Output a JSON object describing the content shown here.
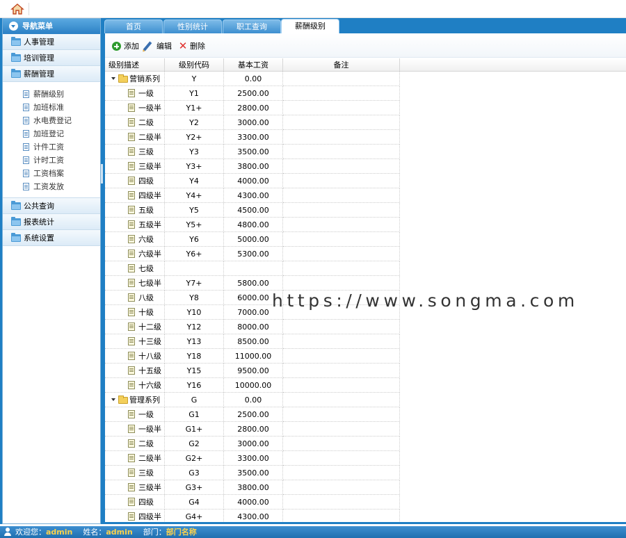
{
  "sidebar": {
    "header": "导航菜单",
    "menus": [
      {
        "label": "人事管理"
      },
      {
        "label": "培训管理"
      },
      {
        "label": "薪酬管理"
      }
    ],
    "submenu": [
      {
        "label": "薪酬级别"
      },
      {
        "label": "加班标准"
      },
      {
        "label": "水电费登记"
      },
      {
        "label": "加班登记"
      },
      {
        "label": "计件工资"
      },
      {
        "label": "计时工资"
      },
      {
        "label": "工资档案"
      },
      {
        "label": "工资发放"
      }
    ],
    "menus2": [
      {
        "label": "公共查询"
      },
      {
        "label": "报表统计"
      },
      {
        "label": "系统设置"
      }
    ]
  },
  "tabs": [
    {
      "label": "首页"
    },
    {
      "label": "性别统计"
    },
    {
      "label": "职工查询"
    },
    {
      "label": "薪酬级别"
    }
  ],
  "toolbar": {
    "add": "添加",
    "edit": "编辑",
    "delete": "删除"
  },
  "grid": {
    "headers": [
      "级别描述",
      "级别代码",
      "基本工资",
      "备注"
    ],
    "rows": [
      {
        "type": "parent",
        "desc": "营销系列",
        "code": "Y",
        "salary": "0.00"
      },
      {
        "type": "leaf",
        "desc": "一级",
        "code": "Y1",
        "salary": "2500.00"
      },
      {
        "type": "leaf",
        "desc": "一级半",
        "code": "Y1+",
        "salary": "2800.00"
      },
      {
        "type": "leaf",
        "desc": "二级",
        "code": "Y2",
        "salary": "3000.00"
      },
      {
        "type": "leaf",
        "desc": "二级半",
        "code": "Y2+",
        "salary": "3300.00"
      },
      {
        "type": "leaf",
        "desc": "三级",
        "code": "Y3",
        "salary": "3500.00"
      },
      {
        "type": "leaf",
        "desc": "三级半",
        "code": "Y3+",
        "salary": "3800.00"
      },
      {
        "type": "leaf",
        "desc": "四级",
        "code": "Y4",
        "salary": "4000.00"
      },
      {
        "type": "leaf",
        "desc": "四级半",
        "code": "Y4+",
        "salary": "4300.00"
      },
      {
        "type": "leaf",
        "desc": "五级",
        "code": "Y5",
        "salary": "4500.00"
      },
      {
        "type": "leaf",
        "desc": "五级半",
        "code": "Y5+",
        "salary": "4800.00"
      },
      {
        "type": "leaf",
        "desc": "六级",
        "code": "Y6",
        "salary": "5000.00"
      },
      {
        "type": "leaf",
        "desc": "六级半",
        "code": "Y6+",
        "salary": "5300.00"
      },
      {
        "type": "leaf",
        "desc": "七级",
        "code": "",
        "salary": ""
      },
      {
        "type": "leaf",
        "desc": "七级半",
        "code": "Y7+",
        "salary": "5800.00"
      },
      {
        "type": "leaf",
        "desc": "八级",
        "code": "Y8",
        "salary": "6000.00"
      },
      {
        "type": "leaf",
        "desc": "十级",
        "code": "Y10",
        "salary": "7000.00"
      },
      {
        "type": "leaf",
        "desc": "十二级",
        "code": "Y12",
        "salary": "8000.00"
      },
      {
        "type": "leaf",
        "desc": "十三级",
        "code": "Y13",
        "salary": "8500.00"
      },
      {
        "type": "leaf",
        "desc": "十八级",
        "code": "Y18",
        "salary": "11000.00"
      },
      {
        "type": "leaf",
        "desc": "十五级",
        "code": "Y15",
        "salary": "9500.00"
      },
      {
        "type": "leaf",
        "desc": "十六级",
        "code": "Y16",
        "salary": "10000.00"
      },
      {
        "type": "parent",
        "desc": "管理系列",
        "code": "G",
        "salary": "0.00"
      },
      {
        "type": "leaf",
        "desc": "一级",
        "code": "G1",
        "salary": "2500.00"
      },
      {
        "type": "leaf",
        "desc": "一级半",
        "code": "G1+",
        "salary": "2800.00"
      },
      {
        "type": "leaf",
        "desc": "二级",
        "code": "G2",
        "salary": "3000.00"
      },
      {
        "type": "leaf",
        "desc": "二级半",
        "code": "G2+",
        "salary": "3300.00"
      },
      {
        "type": "leaf",
        "desc": "三级",
        "code": "G3",
        "salary": "3500.00"
      },
      {
        "type": "leaf",
        "desc": "三级半",
        "code": "G3+",
        "salary": "3800.00"
      },
      {
        "type": "leaf",
        "desc": "四级",
        "code": "G4",
        "salary": "4000.00"
      },
      {
        "type": "leaf",
        "desc": "四级半",
        "code": "G4+",
        "salary": "4300.00"
      }
    ]
  },
  "watermark": "https://www.songma.com",
  "status": {
    "welcome_label": "欢迎您：",
    "welcome_user": "admin",
    "name_label": "姓名：",
    "name_value": "admin",
    "dept_label": "部门：",
    "dept_value": "部门名称"
  }
}
